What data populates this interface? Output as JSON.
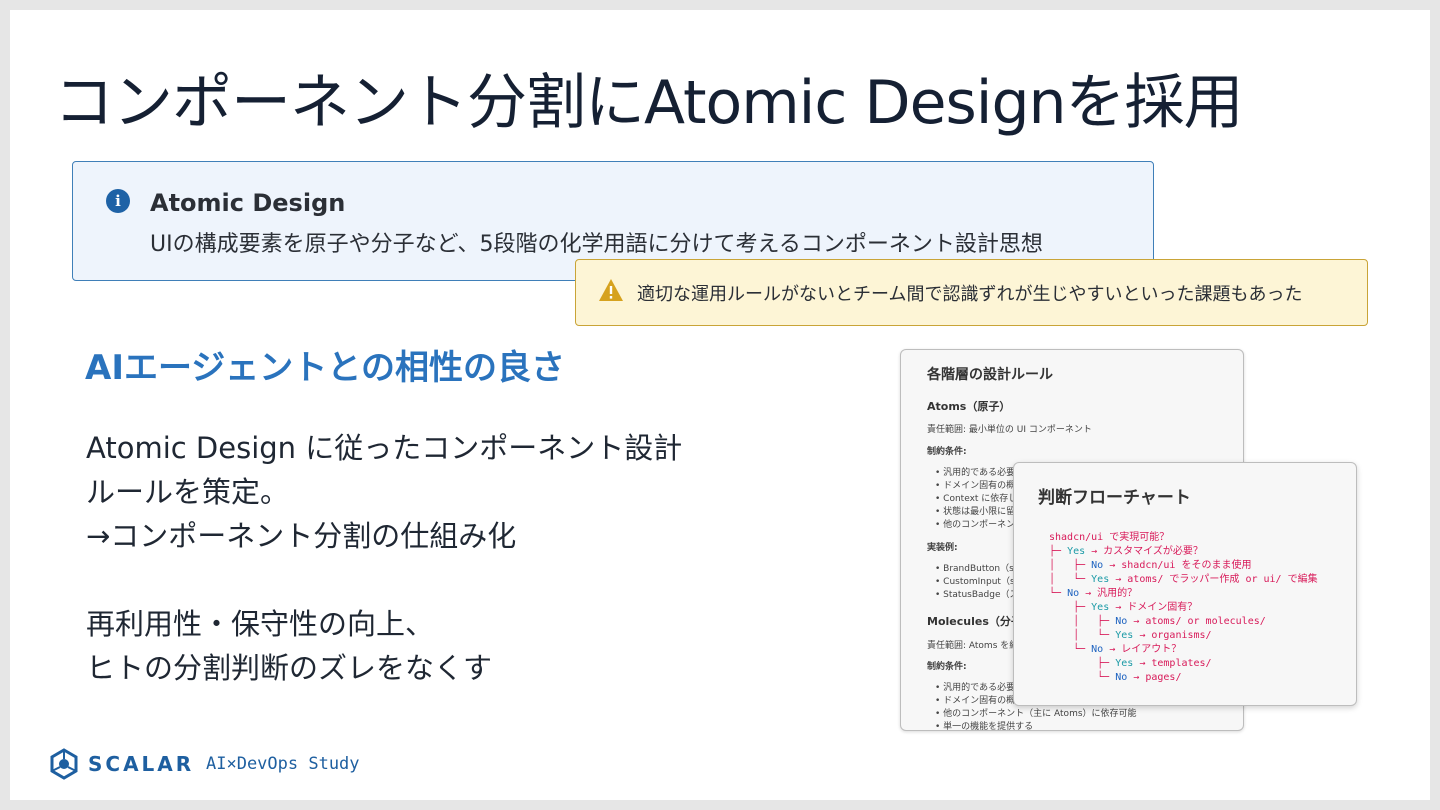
{
  "title": "コンポーネント分割にAtomic Designを採用",
  "info": {
    "icon": "info-icon",
    "heading": "Atomic Design",
    "description": "UIの構成要素を原子や分子など、5段階の化学用語に分けて考えるコンポーネント設計思想"
  },
  "warning": {
    "icon": "warning-icon",
    "text": "適切な運用ルールがないとチーム間で認識ずれが生じやすいといった課題もあった"
  },
  "subheading": "AIエージェントとの相性の良さ",
  "body": {
    "line1": "Atomic Design に従ったコンポーネント設計",
    "line2": "ルールを策定。",
    "line3": "→コンポーネント分割の仕組み化",
    "line4": "再利用性・保守性の向上、",
    "line5": "ヒトの分割判断のズレをなくす"
  },
  "doc_panel": {
    "title": "各階層の設計ルール",
    "atoms_heading": "Atoms（原子）",
    "atoms_scope": "責任範囲: 最小単位の UI コンポーネント",
    "constraints_label": "制約条件:",
    "atoms_constraints": [
      "汎用的である必要",
      "ドメイン固有の概",
      "Context に依存し",
      "状態は最小限に留",
      "他のコンポーネン"
    ],
    "examples_label": "実装例:",
    "atoms_examples": [
      "BrandButton（sh",
      "CustomInput（sh",
      "StatusBadge（ス"
    ],
    "molecules_heading": "Molecules（分子）",
    "molecules_scope": "責任範囲: Atoms を組",
    "molecules_constraints_label": "制約条件:",
    "molecules_constraints": [
      "汎用的である必要",
      "ドメイン固有の概",
      "他のコンポーネント（主に Atoms）に依存可能",
      "単一の機能を提供する"
    ]
  },
  "flow_panel": {
    "title": "判断フローチャート",
    "lines": [
      {
        "prefix": "",
        "label": "",
        "text": "shadcn/ui で実現可能？"
      },
      {
        "prefix": "├─ ",
        "label": "Yes",
        "text": " → カスタマイズが必要？"
      },
      {
        "prefix": "│   ├─ ",
        "label": "No",
        "text": " → shadcn/ui をそのまま使用"
      },
      {
        "prefix": "│   └─ ",
        "label": "Yes",
        "text": " → atoms/ でラッパー作成 or ui/ で編集"
      },
      {
        "prefix": "└─ ",
        "label": "No",
        "text": " → 汎用的？"
      },
      {
        "prefix": "    ├─ ",
        "label": "Yes",
        "text": " → ドメイン固有？"
      },
      {
        "prefix": "    │   ├─ ",
        "label": "No",
        "text": " → atoms/ or molecules/"
      },
      {
        "prefix": "    │   └─ ",
        "label": "Yes",
        "text": " → organisms/"
      },
      {
        "prefix": "    └─ ",
        "label": "No",
        "text": " → レイアウト？"
      },
      {
        "prefix": "        ├─ ",
        "label": "Yes",
        "text": " → templates/"
      },
      {
        "prefix": "        └─ ",
        "label": "No",
        "text": " → pages/"
      }
    ]
  },
  "footer": {
    "logo_icon": "scalar-logo-icon",
    "brand": "SCALAR",
    "subtitle": "AI×DevOps Study"
  },
  "colors": {
    "accent": "#2a73bd",
    "info_bg": "#eef4fc",
    "warn_bg": "#fdf5d6",
    "flow_question": "#d81b5a",
    "flow_yes": "#1b9aa6",
    "flow_no": "#1e63c0"
  }
}
